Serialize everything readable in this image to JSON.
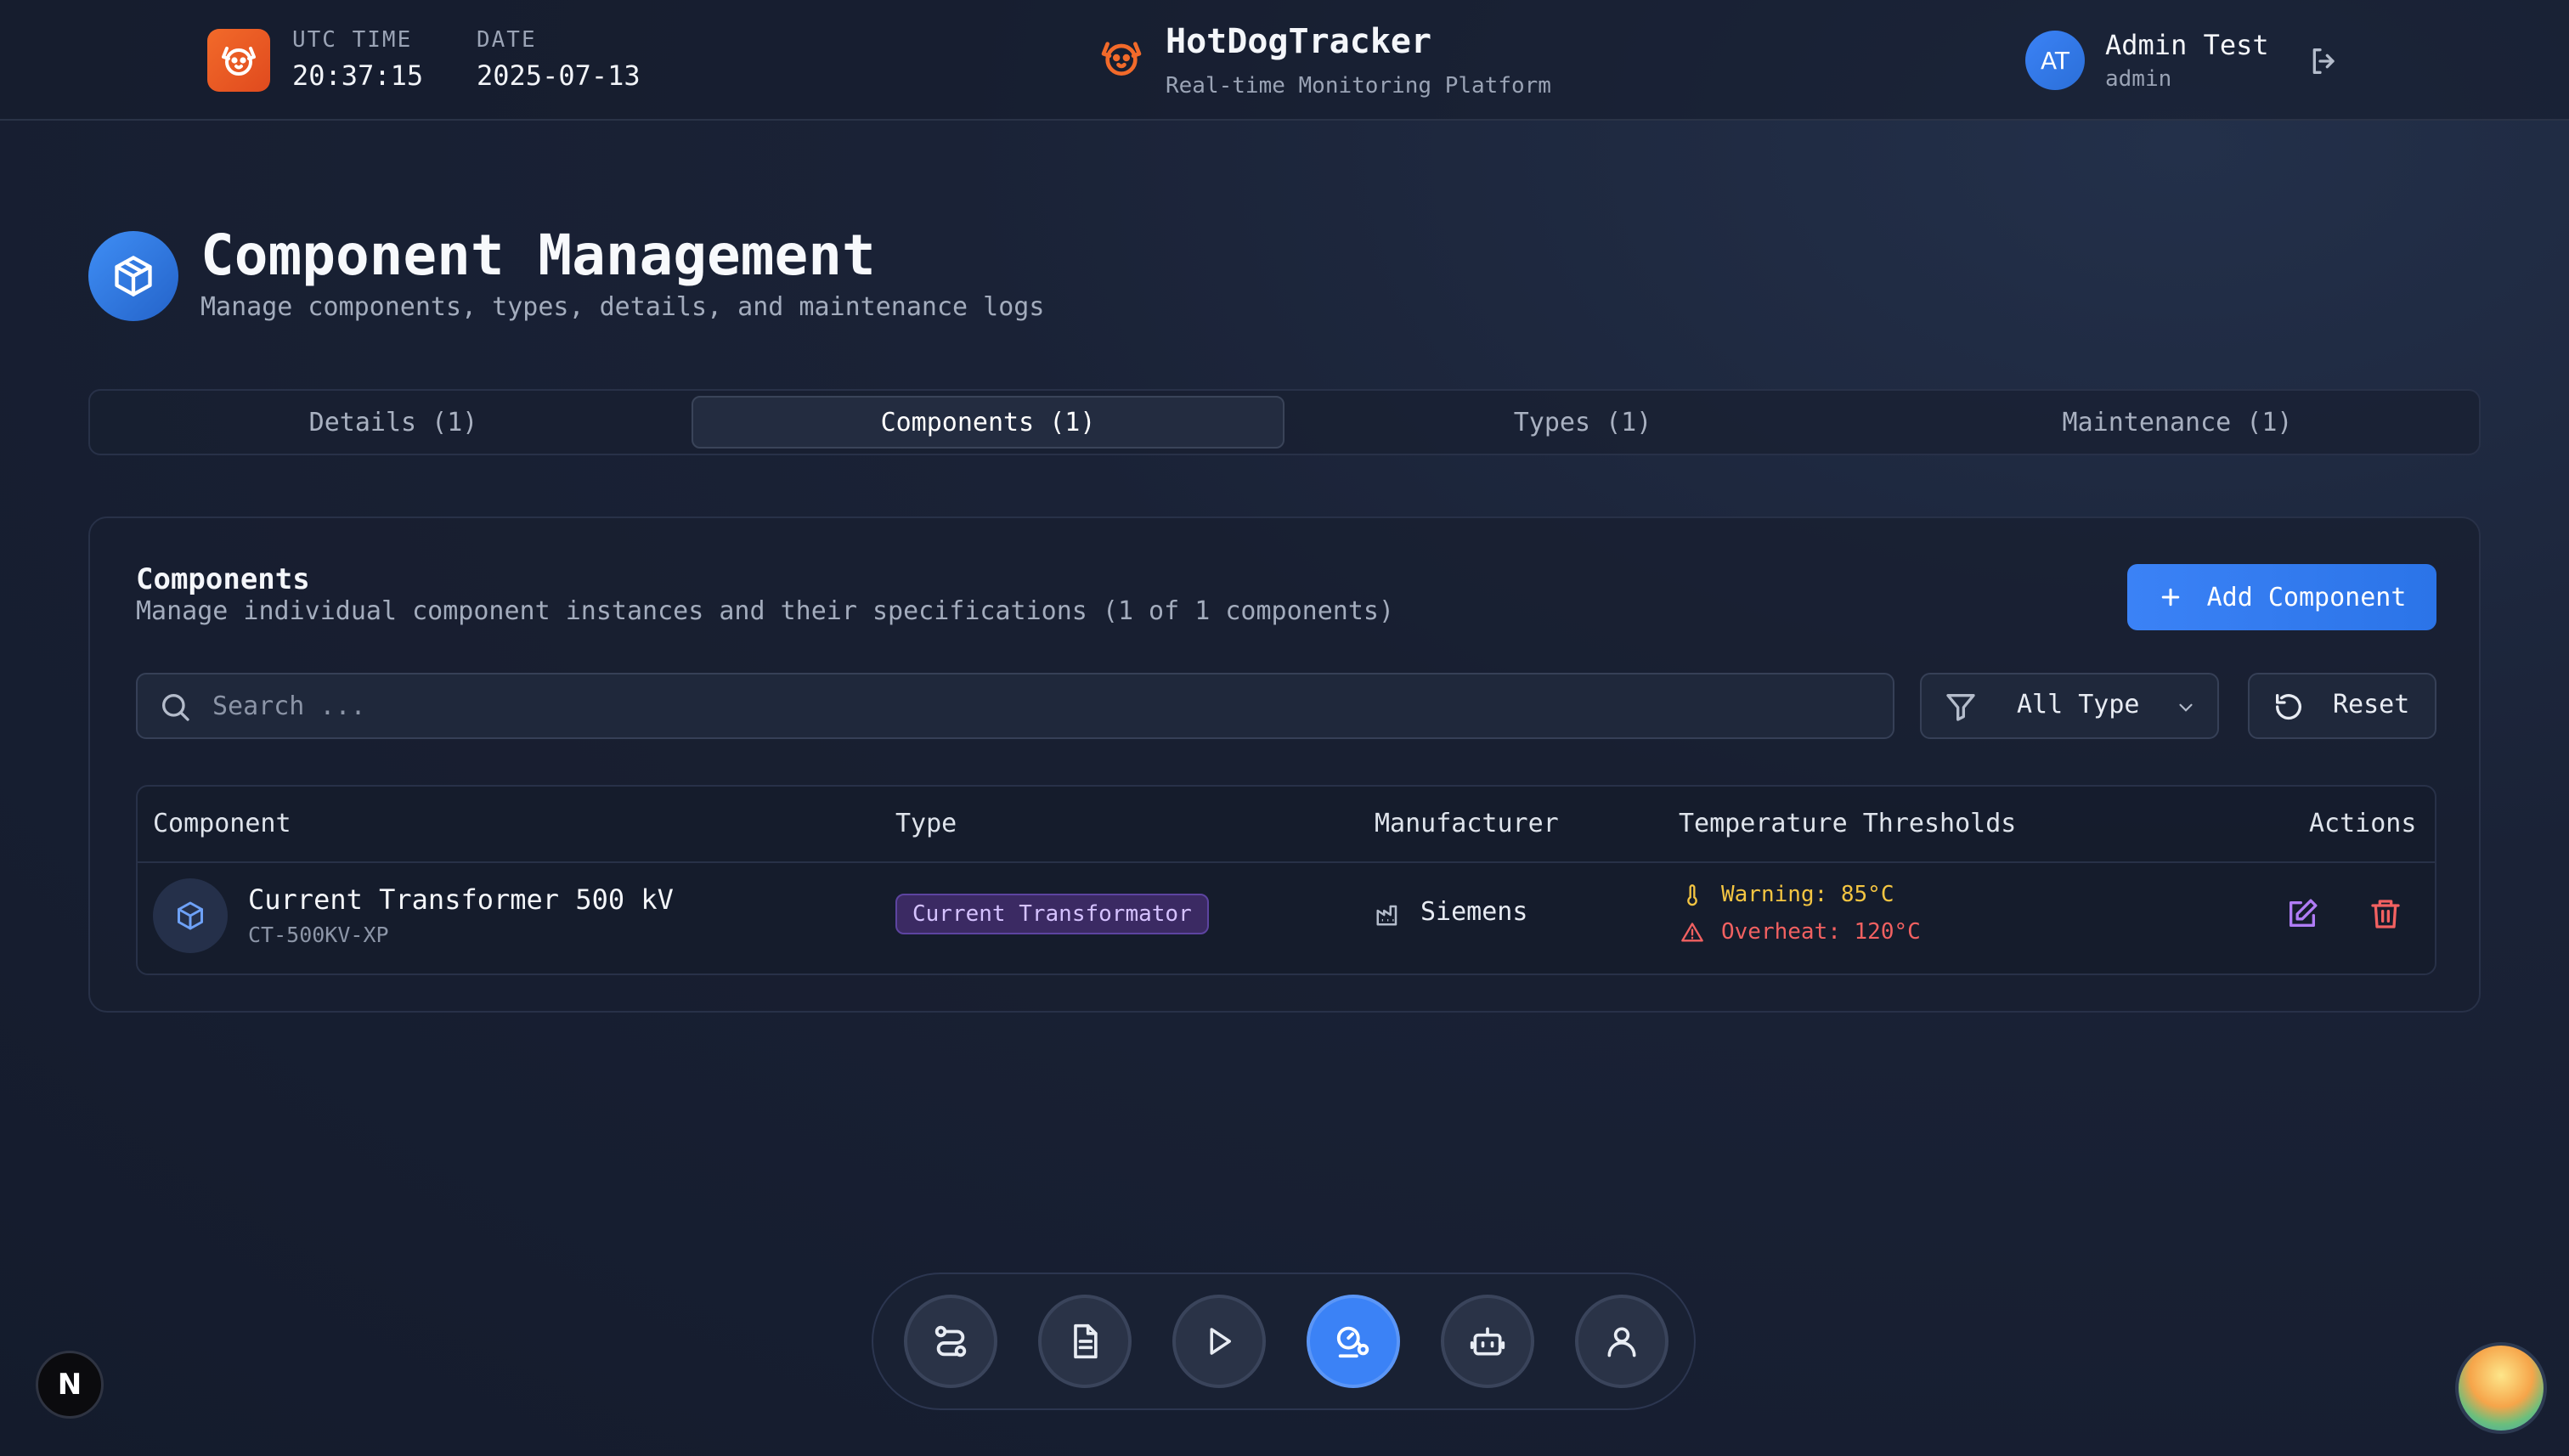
{
  "header": {
    "utc_label": "UTC TIME",
    "utc_value": "20:37:15",
    "date_label": "DATE",
    "date_value": "2025-07-13",
    "brand_title": "HotDogTracker",
    "brand_subtitle": "Real-time Monitoring Platform",
    "avatar_initials": "AT",
    "user_name": "Admin Test",
    "user_role": "admin"
  },
  "page": {
    "title": "Component Management",
    "subtitle": "Manage components, types, details, and maintenance logs"
  },
  "tabs": [
    {
      "label": "Details (1)",
      "active": false
    },
    {
      "label": "Components (1)",
      "active": true
    },
    {
      "label": "Types (1)",
      "active": false
    },
    {
      "label": "Maintenance (1)",
      "active": false
    }
  ],
  "card": {
    "title": "Components",
    "subtitle": "Manage individual component instances and their specifications (1 of 1 components)",
    "add_label": "Add Component",
    "search_placeholder": "Search ...",
    "filter_label": "All Type",
    "reset_label": "Reset"
  },
  "table": {
    "headers": [
      "Component",
      "Type",
      "Manufacturer",
      "Temperature Thresholds",
      "Actions"
    ],
    "rows": [
      {
        "name": "Current Transformer 500 kV",
        "code": "CT-500KV-XP",
        "type": "Current Transformator",
        "manufacturer": "Siemens",
        "warning": "Warning: 85°C",
        "overheat": "Overheat: 120°C"
      }
    ]
  },
  "dock": {
    "items": [
      "routes-icon",
      "document-icon",
      "play-icon",
      "monitoring-icon",
      "robot-icon",
      "user-icon"
    ],
    "active": "monitoring-icon"
  },
  "misc": {
    "next_badge": "N"
  },
  "colors": {
    "accent": "#3b82f6",
    "warning": "#f4c542",
    "danger": "#f26161",
    "type_badge": "#d5c2ff",
    "brand_orange": "#f26a2a"
  }
}
